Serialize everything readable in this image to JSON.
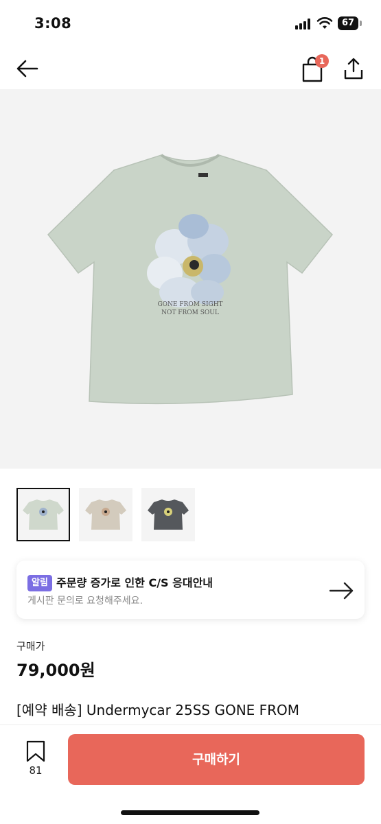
{
  "status_bar": {
    "time": "3:08",
    "battery": "67"
  },
  "nav": {
    "cart_count": "1"
  },
  "product_image": {
    "print_text_line1": "GONE FROM SIGHT",
    "print_text_line2": "NOT FROM SOUL",
    "shirt_color": "#c9d4c8"
  },
  "thumbnails": [
    {
      "color": "#cfd8cc",
      "selected": true
    },
    {
      "color": "#d3cbbd",
      "selected": false
    },
    {
      "color": "#55585c",
      "selected": false
    }
  ],
  "notice": {
    "tag": "알림",
    "title": "주문량 증가로 인한 C/S 응대안내",
    "subtitle": "게시판 문의로 요청해주세요."
  },
  "price": {
    "label": "구매가",
    "value": "79,000원"
  },
  "product": {
    "title": "[예약 배송] Undermycar 25SS GONE FROM"
  },
  "bottom": {
    "bookmark_count": "81",
    "buy_label": "구매하기"
  },
  "colors": {
    "accent": "#e8675a",
    "tag_purple": "#7b6ee3"
  }
}
